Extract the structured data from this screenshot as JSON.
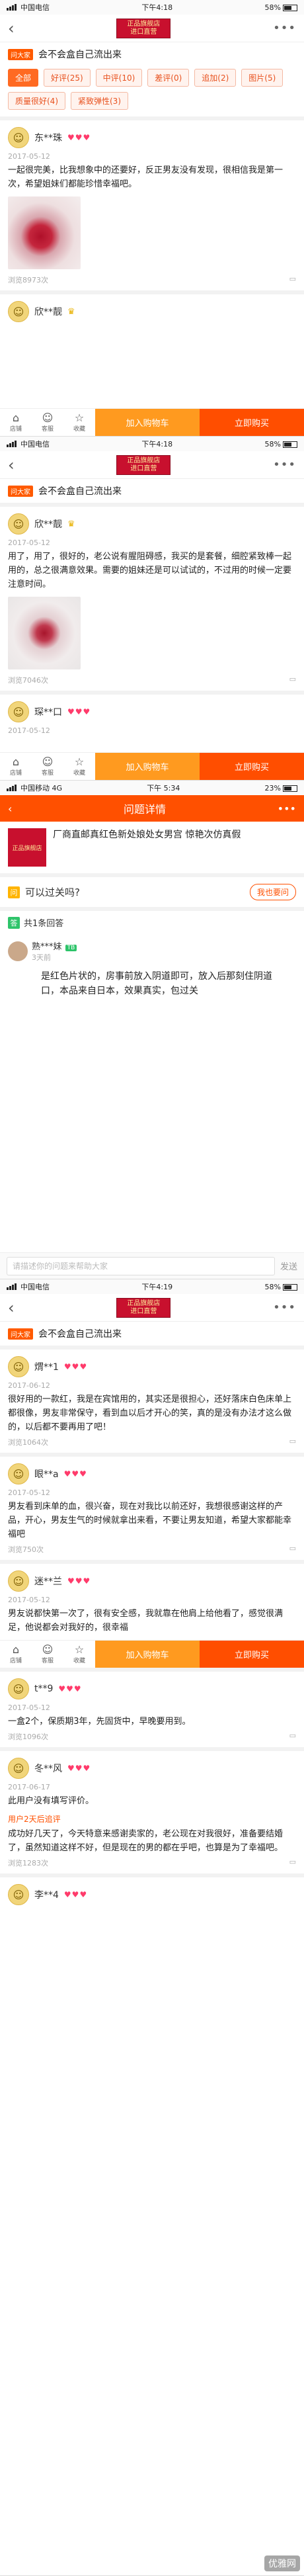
{
  "status1": {
    "carrier": "中国电信",
    "time": "下午4:18",
    "battery": "58%"
  },
  "status2": {
    "carrier": "中国电信",
    "time": "下午4:18",
    "battery": "58%"
  },
  "status3": {
    "carrier": "中国移动  4G",
    "time": "下午 5:34",
    "battery": "23%"
  },
  "status4": {
    "carrier": "中国电信",
    "time": "下午4:19",
    "battery": "58%"
  },
  "logo": {
    "line1": "正品旗舰店",
    "line2": "进口直营"
  },
  "question_banner": {
    "tag": "问大家",
    "text": "会不会盒自己流出来"
  },
  "filter_tags": [
    "全部",
    "好评(25)",
    "中评(10)",
    "差评(0)",
    "追加(2)",
    "图片(5)",
    "质量很好(4)",
    "紧致弹性(3)"
  ],
  "reviews": [
    {
      "name": "东**珠",
      "date": "2017-05-12",
      "text": "一起很完美，比我想象中的还要好，反正男友没有发现，很相信我是第一次，希望姐妹们都能珍惜幸福吧。",
      "views": "浏览8973次",
      "has_photo": true,
      "hearts": "♥♥♥"
    },
    {
      "name": "欣**靓",
      "date": "2017-05-12",
      "text": "用了，用了，很好的，老公说有腥阻碍感，我买的是套餐，细腔紧致棒一起用的，总之很满意效果。需要的姐妹还是可以试试的，不过用的时候一定要注意时间。",
      "views": "浏览7046次",
      "has_photo": true,
      "hearts": ""
    },
    {
      "name": "琛**口",
      "date": "2017-05-12",
      "text": "",
      "views": "",
      "has_photo": false,
      "hearts": "♥♥♥"
    }
  ],
  "bottom": {
    "shop": "店铺",
    "service": "客服",
    "fav": "收藏",
    "cart": "加入购物车",
    "buy": "立即购买"
  },
  "qa": {
    "title": "问题详情",
    "product_title": "厂商直邮真红色新处娘处女男宫 惊艳次仿真假",
    "question": "可以过关吗?",
    "ask_button": "我也要问",
    "answer_count": "共1条回答",
    "answerer": "熟***妹",
    "badge": "TB",
    "answer_time": "3天前",
    "answer": "是红色片状的，房事前放入阴道即可，放入后那刻住阴道口，本品来自日本，效果真实，包过关",
    "input_placeholder": "请描述你的问题来帮助大家",
    "send": "发送"
  },
  "reviews2": [
    {
      "name": "煟**1",
      "date": "2017-06-12",
      "text": "很好用的一款红，我是在宾馆用的，其实还是很担心，还好落床白色床单上都很像，男友非常保守，看到血以后才开心的笑，真的是没有办法才这么做的，以后都不要再用了吧！",
      "views": "浏览1064次",
      "hearts": "♥♥♥"
    },
    {
      "name": "眼**a",
      "date": "2017-05-12",
      "text": "男友看到床单的血，很兴奋，现在对我比以前还好，我想很感谢这样的产品，开心，男友生气的时候就拿出来看，不要让男友知道，希望大家都能幸福吧",
      "views": "浏览750次",
      "hearts": "♥♥♥"
    },
    {
      "name": "迷**兰",
      "date": "2017-05-12",
      "text": "男友说都快第一次了，很有安全感，我就靠在他肩上给他看了，感觉很满足，他说都会对我好的，很幸福",
      "views": "",
      "hearts": "♥♥♥"
    },
    {
      "name": "t**9",
      "date": "2017-05-12",
      "text": "一盒2个，保质期3年，先固货中，早晚要用到。",
      "views": "浏览1096次",
      "hearts": "♥♥♥"
    },
    {
      "name": "冬**风",
      "date": "2017-06-17",
      "text": "此用户没有填写评价。",
      "append_label": "用户2天后追评",
      "append": "成功好几天了，今天特意来感谢卖家的，老公现在对我很好，准备要结婚了，虽然知道这样不好，但是现在的男的都在乎吧，也算是为了幸福吧。",
      "views": "浏览1283次",
      "hearts": "♥♥♥"
    },
    {
      "name": "李**4",
      "date": "",
      "text": "",
      "views": "",
      "hearts": "♥♥♥"
    }
  ],
  "watermark": "优雅网"
}
